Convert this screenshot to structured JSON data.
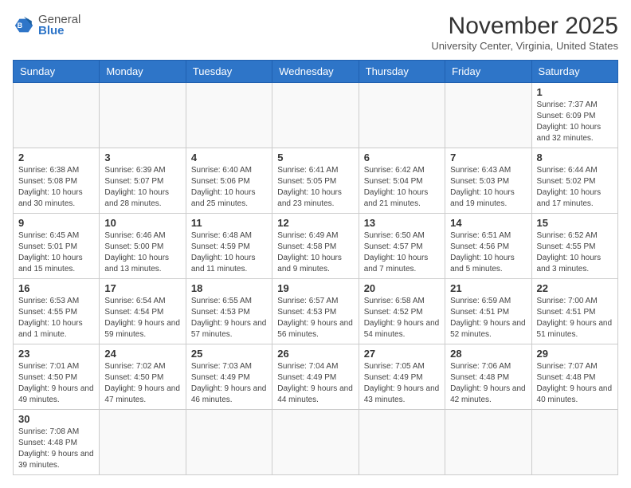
{
  "logo": {
    "line1": "General",
    "line2": "Blue"
  },
  "calendar": {
    "title": "November 2025",
    "subtitle": "University Center, Virginia, United States",
    "headers": [
      "Sunday",
      "Monday",
      "Tuesday",
      "Wednesday",
      "Thursday",
      "Friday",
      "Saturday"
    ],
    "weeks": [
      [
        {
          "day": "",
          "info": ""
        },
        {
          "day": "",
          "info": ""
        },
        {
          "day": "",
          "info": ""
        },
        {
          "day": "",
          "info": ""
        },
        {
          "day": "",
          "info": ""
        },
        {
          "day": "",
          "info": ""
        },
        {
          "day": "1",
          "info": "Sunrise: 7:37 AM\nSunset: 6:09 PM\nDaylight: 10 hours\nand 32 minutes."
        }
      ],
      [
        {
          "day": "2",
          "info": "Sunrise: 6:38 AM\nSunset: 5:08 PM\nDaylight: 10 hours\nand 30 minutes."
        },
        {
          "day": "3",
          "info": "Sunrise: 6:39 AM\nSunset: 5:07 PM\nDaylight: 10 hours\nand 28 minutes."
        },
        {
          "day": "4",
          "info": "Sunrise: 6:40 AM\nSunset: 5:06 PM\nDaylight: 10 hours\nand 25 minutes."
        },
        {
          "day": "5",
          "info": "Sunrise: 6:41 AM\nSunset: 5:05 PM\nDaylight: 10 hours\nand 23 minutes."
        },
        {
          "day": "6",
          "info": "Sunrise: 6:42 AM\nSunset: 5:04 PM\nDaylight: 10 hours\nand 21 minutes."
        },
        {
          "day": "7",
          "info": "Sunrise: 6:43 AM\nSunset: 5:03 PM\nDaylight: 10 hours\nand 19 minutes."
        },
        {
          "day": "8",
          "info": "Sunrise: 6:44 AM\nSunset: 5:02 PM\nDaylight: 10 hours\nand 17 minutes."
        }
      ],
      [
        {
          "day": "9",
          "info": "Sunrise: 6:45 AM\nSunset: 5:01 PM\nDaylight: 10 hours\nand 15 minutes."
        },
        {
          "day": "10",
          "info": "Sunrise: 6:46 AM\nSunset: 5:00 PM\nDaylight: 10 hours\nand 13 minutes."
        },
        {
          "day": "11",
          "info": "Sunrise: 6:48 AM\nSunset: 4:59 PM\nDaylight: 10 hours\nand 11 minutes."
        },
        {
          "day": "12",
          "info": "Sunrise: 6:49 AM\nSunset: 4:58 PM\nDaylight: 10 hours\nand 9 minutes."
        },
        {
          "day": "13",
          "info": "Sunrise: 6:50 AM\nSunset: 4:57 PM\nDaylight: 10 hours\nand 7 minutes."
        },
        {
          "day": "14",
          "info": "Sunrise: 6:51 AM\nSunset: 4:56 PM\nDaylight: 10 hours\nand 5 minutes."
        },
        {
          "day": "15",
          "info": "Sunrise: 6:52 AM\nSunset: 4:55 PM\nDaylight: 10 hours\nand 3 minutes."
        }
      ],
      [
        {
          "day": "16",
          "info": "Sunrise: 6:53 AM\nSunset: 4:55 PM\nDaylight: 10 hours\nand 1 minute."
        },
        {
          "day": "17",
          "info": "Sunrise: 6:54 AM\nSunset: 4:54 PM\nDaylight: 9 hours\nand 59 minutes."
        },
        {
          "day": "18",
          "info": "Sunrise: 6:55 AM\nSunset: 4:53 PM\nDaylight: 9 hours\nand 57 minutes."
        },
        {
          "day": "19",
          "info": "Sunrise: 6:57 AM\nSunset: 4:53 PM\nDaylight: 9 hours\nand 56 minutes."
        },
        {
          "day": "20",
          "info": "Sunrise: 6:58 AM\nSunset: 4:52 PM\nDaylight: 9 hours\nand 54 minutes."
        },
        {
          "day": "21",
          "info": "Sunrise: 6:59 AM\nSunset: 4:51 PM\nDaylight: 9 hours\nand 52 minutes."
        },
        {
          "day": "22",
          "info": "Sunrise: 7:00 AM\nSunset: 4:51 PM\nDaylight: 9 hours\nand 51 minutes."
        }
      ],
      [
        {
          "day": "23",
          "info": "Sunrise: 7:01 AM\nSunset: 4:50 PM\nDaylight: 9 hours\nand 49 minutes."
        },
        {
          "day": "24",
          "info": "Sunrise: 7:02 AM\nSunset: 4:50 PM\nDaylight: 9 hours\nand 47 minutes."
        },
        {
          "day": "25",
          "info": "Sunrise: 7:03 AM\nSunset: 4:49 PM\nDaylight: 9 hours\nand 46 minutes."
        },
        {
          "day": "26",
          "info": "Sunrise: 7:04 AM\nSunset: 4:49 PM\nDaylight: 9 hours\nand 44 minutes."
        },
        {
          "day": "27",
          "info": "Sunrise: 7:05 AM\nSunset: 4:49 PM\nDaylight: 9 hours\nand 43 minutes."
        },
        {
          "day": "28",
          "info": "Sunrise: 7:06 AM\nSunset: 4:48 PM\nDaylight: 9 hours\nand 42 minutes."
        },
        {
          "day": "29",
          "info": "Sunrise: 7:07 AM\nSunset: 4:48 PM\nDaylight: 9 hours\nand 40 minutes."
        }
      ],
      [
        {
          "day": "30",
          "info": "Sunrise: 7:08 AM\nSunset: 4:48 PM\nDaylight: 9 hours\nand 39 minutes."
        },
        {
          "day": "",
          "info": ""
        },
        {
          "day": "",
          "info": ""
        },
        {
          "day": "",
          "info": ""
        },
        {
          "day": "",
          "info": ""
        },
        {
          "day": "",
          "info": ""
        },
        {
          "day": "",
          "info": ""
        }
      ]
    ]
  }
}
